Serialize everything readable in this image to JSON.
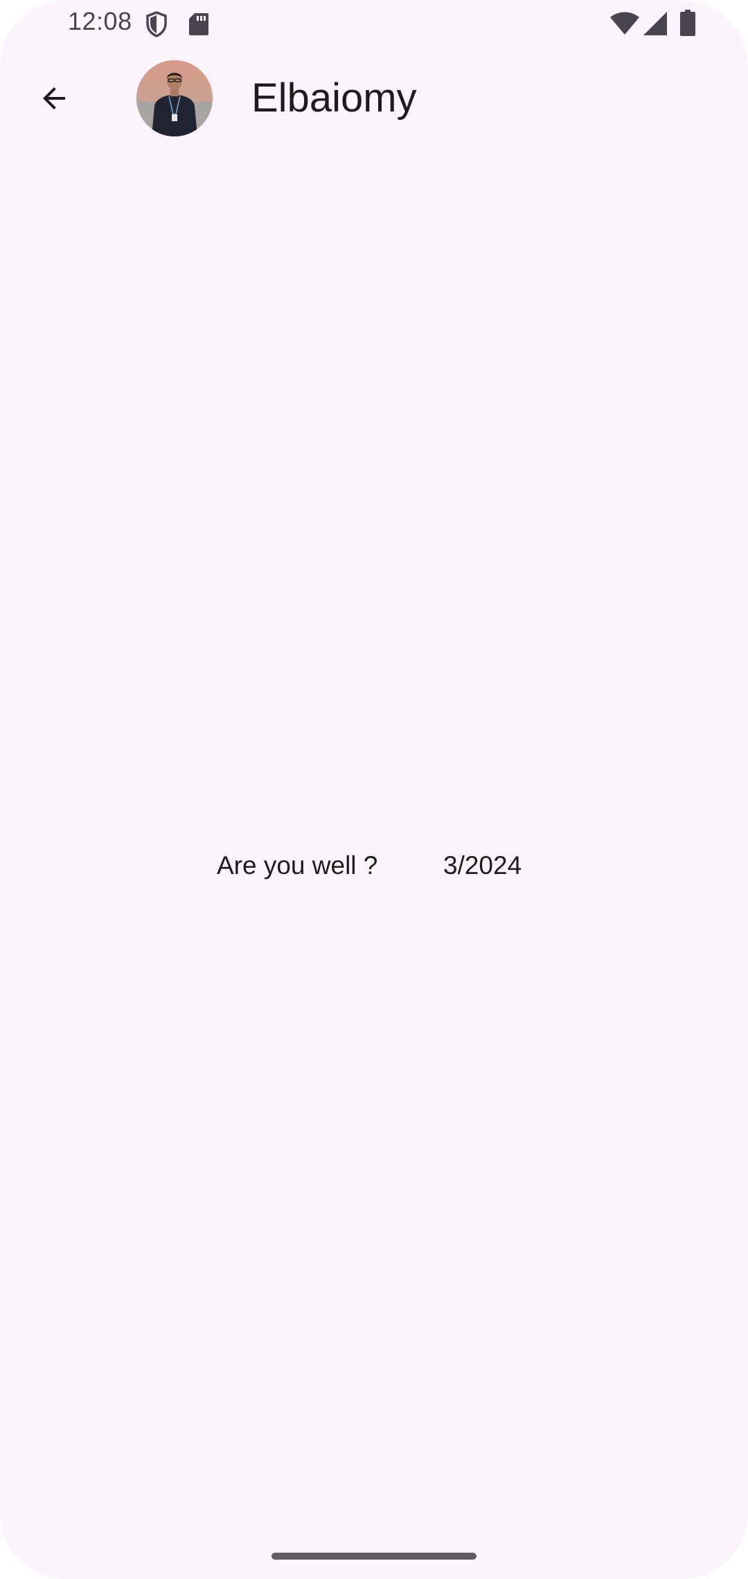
{
  "status_bar": {
    "time": "12:08",
    "icons": [
      "shield-icon",
      "sd-card-icon",
      "wifi-icon",
      "signal-icon",
      "battery-icon"
    ]
  },
  "app_bar": {
    "back_icon": "arrow-back-icon",
    "contact_name": "Elbaiomy",
    "avatar": "contact-avatar-photo"
  },
  "messages": [
    {
      "text": "Are you well ?",
      "date": "3/2024"
    }
  ],
  "colors": {
    "background": "#fcf4fc",
    "text": "#1d1b20",
    "status_text": "#49454f"
  }
}
